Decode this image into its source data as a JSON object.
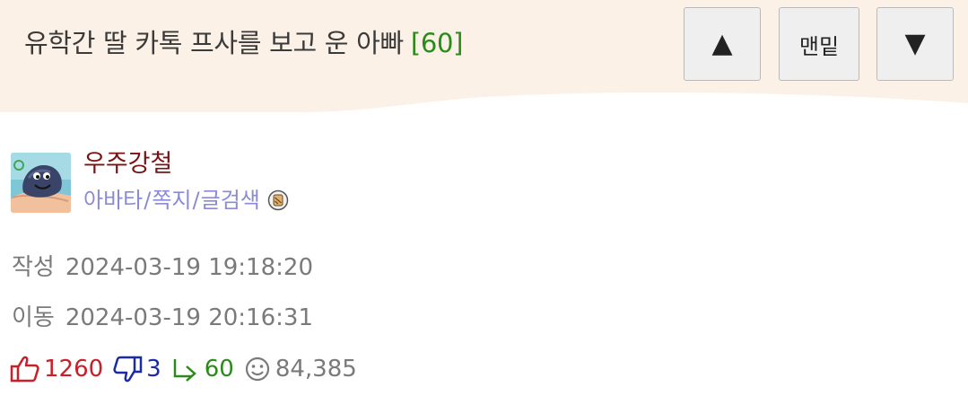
{
  "post": {
    "title": "유학간 딸 카톡 프사를 보고 운 아빠",
    "comment_count": "[60]"
  },
  "nav": {
    "up_icon": "triangle-up-icon",
    "up_glyph": "▲",
    "bottom_label": "맨밑",
    "down_icon": "triangle-down-icon",
    "down_glyph": "▼"
  },
  "author": {
    "name": "우주강철",
    "links": [
      "아바타",
      "쪽지",
      "글검색"
    ],
    "link_separator": "/",
    "badge_icon": "level-badge-icon"
  },
  "meta": {
    "created_label": "작성",
    "created_value": "2024-03-19 19:18:20",
    "moved_label": "이동",
    "moved_value": "2024-03-19 20:16:31"
  },
  "stats": {
    "upvotes": "1260",
    "downvotes": "3",
    "replies": "60",
    "views": "84,385"
  },
  "colors": {
    "header_bg": "#fbf1e6",
    "title_text": "#3a3a3a",
    "comment_count": "#2c8a1a",
    "username": "#7a1212",
    "links": "#8a8ad8",
    "meta": "#7a7a7a",
    "upvote": "#c8202a",
    "downvote": "#1b2aa8",
    "reply": "#2c8a1a"
  }
}
